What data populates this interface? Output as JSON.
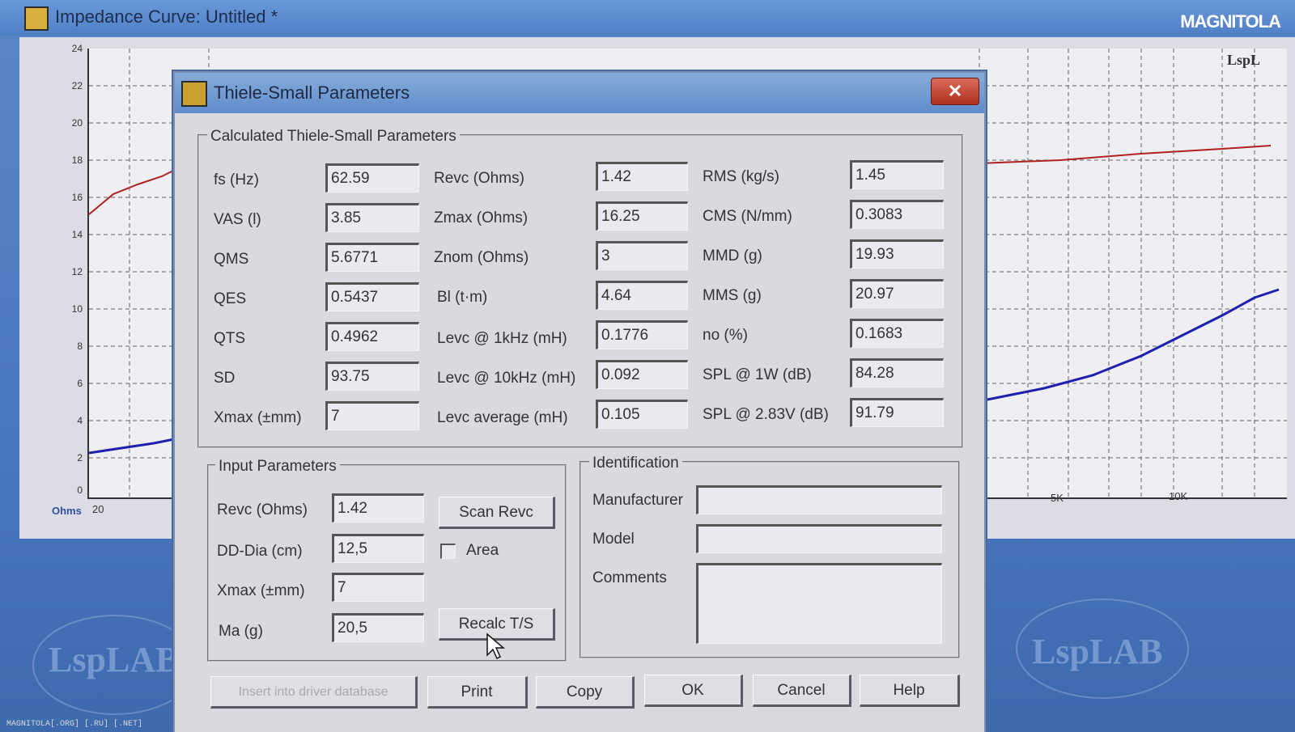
{
  "window": {
    "title": "Impedance Curve: Untitled *",
    "logo": "MAGNITOLA"
  },
  "plot": {
    "y_ticks": [
      "24",
      "22",
      "20",
      "18",
      "16",
      "14",
      "12",
      "10",
      "8",
      "6",
      "4",
      "2",
      "0"
    ],
    "x_ticks": [
      "20",
      "5K",
      "10K"
    ],
    "y_unit": "Ohms",
    "corner_label": "LspL"
  },
  "watermark": {
    "text": "LspLAB",
    "footer": "MAGNITOLA[.ORG] [.RU] [.NET]"
  },
  "dialog": {
    "title": "Thiele-Small Parameters",
    "close_label": "✕",
    "calculated": {
      "group_label": "Calculated Thiele-Small Parameters",
      "col1": [
        {
          "label": "fs (Hz)",
          "value": "62.59"
        },
        {
          "label": "VAS (l)",
          "value": "3.85"
        },
        {
          "label": "QMS",
          "value": "5.6771"
        },
        {
          "label": "QES",
          "value": "0.5437"
        },
        {
          "label": "QTS",
          "value": "0.4962"
        },
        {
          "label": "SD",
          "value": "93.75"
        },
        {
          "label": "Xmax (±mm)",
          "value": "7"
        }
      ],
      "col2": [
        {
          "label": "Revc (Ohms)",
          "value": "1.42"
        },
        {
          "label": "Zmax (Ohms)",
          "value": "16.25"
        },
        {
          "label": "Znom (Ohms)",
          "value": "3"
        },
        {
          "label": "Bl (t·m)",
          "value": "4.64"
        },
        {
          "label": "Levc @ 1kHz (mH)",
          "value": "0.1776"
        },
        {
          "label": "Levc @ 10kHz (mH)",
          "value": "0.092"
        },
        {
          "label": "Levc average (mH)",
          "value": "0.105"
        }
      ],
      "col3": [
        {
          "label": "RMS (kg/s)",
          "value": "1.45"
        },
        {
          "label": "CMS (N/mm)",
          "value": "0.3083"
        },
        {
          "label": "MMD (g)",
          "value": "19.93"
        },
        {
          "label": "MMS (g)",
          "value": "20.97"
        },
        {
          "label": "no (%)",
          "value": "0.1683"
        },
        {
          "label": "SPL @ 1W (dB)",
          "value": "84.28"
        },
        {
          "label": "SPL @ 2.83V (dB)",
          "value": "91.79"
        }
      ]
    },
    "input": {
      "group_label": "Input Parameters",
      "revc": {
        "label": "Revc (Ohms)",
        "value": "1.42"
      },
      "dd": {
        "label": "DD-Dia (cm)",
        "value": "12,5"
      },
      "xmax": {
        "label": "Xmax (±mm)",
        "value": "7"
      },
      "ma": {
        "label": "Ma (g)",
        "value": "20,5"
      },
      "scan_button": "Scan Revc",
      "area_label": "Area",
      "recalc_button": "Recalc T/S"
    },
    "identification": {
      "group_label": "Identification",
      "manufacturer_label": "Manufacturer",
      "model_label": "Model",
      "comments_label": "Comments",
      "manufacturer": "",
      "model": "",
      "comments": ""
    },
    "buttons": {
      "insert": "Insert into driver database",
      "print": "Print",
      "copy": "Copy",
      "ok": "OK",
      "cancel": "Cancel",
      "help": "Help"
    }
  }
}
